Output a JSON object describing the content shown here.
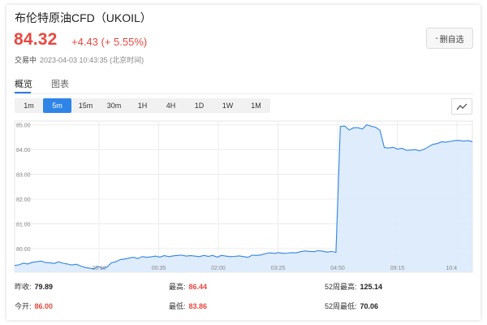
{
  "header": {
    "title": "布伦特原油CFD（UKOIL）",
    "price": "84.32",
    "change": "+4.43 (+ 5.55%)",
    "status": "交易中",
    "timestamp": "2023-04-03 10:43:35 (北京时间)",
    "remove_button_label": "删自选",
    "remove_button_icon": "-"
  },
  "tabs": [
    {
      "label": "概览",
      "active": true
    },
    {
      "label": "图表",
      "active": false
    }
  ],
  "intervals": [
    {
      "label": "1m",
      "active": false
    },
    {
      "label": "5m",
      "active": true
    },
    {
      "label": "15m",
      "active": false
    },
    {
      "label": "30m",
      "active": false
    },
    {
      "label": "1H",
      "active": false
    },
    {
      "label": "4H",
      "active": false
    },
    {
      "label": "1D",
      "active": false
    },
    {
      "label": "1W",
      "active": false
    },
    {
      "label": "1M",
      "active": false
    }
  ],
  "chart_toggle_icon": "line-chart-icon",
  "colors": {
    "accent": "#2f84e8",
    "up": "#e8473f",
    "line": "#2f84e8",
    "fill": "#dbeafb"
  },
  "chart_data": {
    "type": "area",
    "title": "",
    "xlabel": "",
    "ylabel": "",
    "ylim": [
      79.05,
      85.15
    ],
    "yticks": [
      "85.00",
      "84.00",
      "83.00",
      "82.00",
      "81.00",
      "80.00"
    ],
    "xticks": [
      "23:10",
      "00:35",
      "02:00",
      "03:25",
      "04:50",
      "09:15",
      "10:4"
    ],
    "grid": true,
    "series": [
      {
        "name": "",
        "values": [
          79.32,
          79.35,
          79.41,
          79.38,
          79.45,
          79.47,
          79.5,
          79.44,
          79.43,
          79.4,
          79.47,
          79.41,
          79.38,
          79.34,
          79.37,
          79.3,
          79.24,
          79.21,
          79.19,
          79.28,
          79.2,
          79.26,
          79.43,
          79.47,
          79.56,
          79.58,
          79.62,
          79.65,
          79.6,
          79.68,
          79.65,
          79.67,
          79.7,
          79.66,
          79.72,
          79.68,
          79.71,
          79.73,
          79.74,
          79.7,
          79.72,
          79.7,
          79.68,
          79.73,
          79.69,
          79.73,
          79.66,
          79.73,
          79.7,
          79.68,
          79.69,
          79.71,
          79.68,
          79.65,
          79.74,
          79.73,
          79.75,
          79.8,
          79.83,
          79.81,
          79.84,
          79.81,
          79.82,
          79.84,
          79.83,
          79.88,
          79.91,
          79.89,
          79.88,
          79.92,
          79.9,
          79.86,
          79.89,
          79.85,
          84.93,
          84.95,
          84.79,
          84.88,
          84.88,
          84.83,
          85.0,
          84.94,
          84.9,
          84.78,
          84.08,
          84.06,
          84.09,
          84.02,
          84.05,
          83.97,
          83.98,
          84.0,
          83.95,
          84.01,
          84.11,
          84.21,
          84.24,
          84.31,
          84.3,
          84.33,
          84.36,
          84.37,
          84.34,
          84.36,
          84.32
        ]
      }
    ]
  },
  "stats": [
    {
      "label": "昨收:",
      "value": "79.89",
      "tone": "dark"
    },
    {
      "label": "最高:",
      "value": "86.44",
      "tone": "red"
    },
    {
      "label": "52周最高:",
      "value": "125.14",
      "tone": "dark"
    },
    {
      "label": "今开:",
      "value": "86.00",
      "tone": "red"
    },
    {
      "label": "最低:",
      "value": "83.86",
      "tone": "red"
    },
    {
      "label": "52周最低:",
      "value": "70.06",
      "tone": "dark"
    }
  ]
}
